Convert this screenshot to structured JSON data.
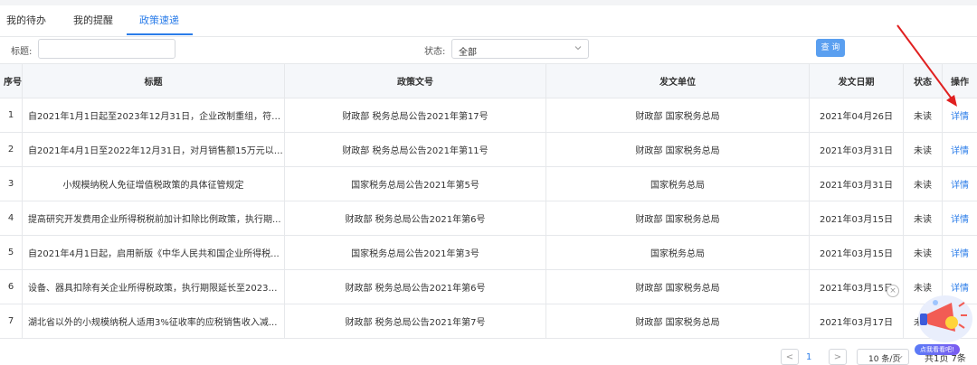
{
  "tabs": [
    {
      "label": "我的待办",
      "active": false
    },
    {
      "label": "我的提醒",
      "active": false
    },
    {
      "label": "政策速递",
      "active": true
    }
  ],
  "filters": {
    "title_label": "标题:",
    "title_value": "",
    "status_label": "状态:",
    "status_value": "全部",
    "query_button": "查 询"
  },
  "table": {
    "columns": [
      "序号",
      "标题",
      "政策文号",
      "发文单位",
      "发文日期",
      "状态",
      "操作"
    ],
    "rows": [
      {
        "no": "1",
        "title": "自2021年1月1日起至2023年12月31日，企业改制重组，符合...",
        "doc_no": "财政部 税务总局公告2021年第17号",
        "issuer": "财政部 国家税务总局",
        "date": "2021年04月26日",
        "status": "未读",
        "action": "详情"
      },
      {
        "no": "2",
        "title": "自2021年4月1日至2022年12月31日，对月销售额15万元以下...",
        "doc_no": "财政部 税务总局公告2021年第11号",
        "issuer": "财政部 国家税务总局",
        "date": "2021年03月31日",
        "status": "未读",
        "action": "详情"
      },
      {
        "no": "3",
        "title": "小规模纳税人免征增值税政策的具体征管规定",
        "doc_no": "国家税务总局公告2021年第5号",
        "issuer": "国家税务总局",
        "date": "2021年03月31日",
        "status": "未读",
        "action": "详情"
      },
      {
        "no": "4",
        "title": "提高研究开发费用企业所得税税前加计扣除比例政策，执行期...",
        "doc_no": "财政部 税务总局公告2021年第6号",
        "issuer": "财政部 国家税务总局",
        "date": "2021年03月15日",
        "status": "未读",
        "action": "详情"
      },
      {
        "no": "5",
        "title": "自2021年4月1日起，启用新版《中华人民共和国企业所得税...",
        "doc_no": "国家税务总局公告2021年第3号",
        "issuer": "国家税务总局",
        "date": "2021年03月15日",
        "status": "未读",
        "action": "详情"
      },
      {
        "no": "6",
        "title": "设备、器具扣除有关企业所得税政策，执行期限延长至2023年...",
        "doc_no": "财政部 税务总局公告2021年第6号",
        "issuer": "财政部 国家税务总局",
        "date": "2021年03月15日",
        "status": "未读",
        "action": "详情"
      },
      {
        "no": "7",
        "title": "湖北省以外的小规模纳税人适用3%征收率的应税销售收入减...",
        "doc_no": "财政部 税务总局公告2021年第7号",
        "issuer": "财政部 国家税务总局",
        "date": "2021年03月17日",
        "status": "未读",
        "action": "详情"
      }
    ]
  },
  "pagination": {
    "prev": "<",
    "current": "1",
    "next": ">",
    "page_size": "10 条/页",
    "total": "共1页 7条"
  },
  "widget": {
    "close": "×",
    "label": "点我看看吧!"
  },
  "colors": {
    "accent": "#2b7de9",
    "query_button": "#5a9ff0",
    "annotation_arrow": "#e02020"
  }
}
